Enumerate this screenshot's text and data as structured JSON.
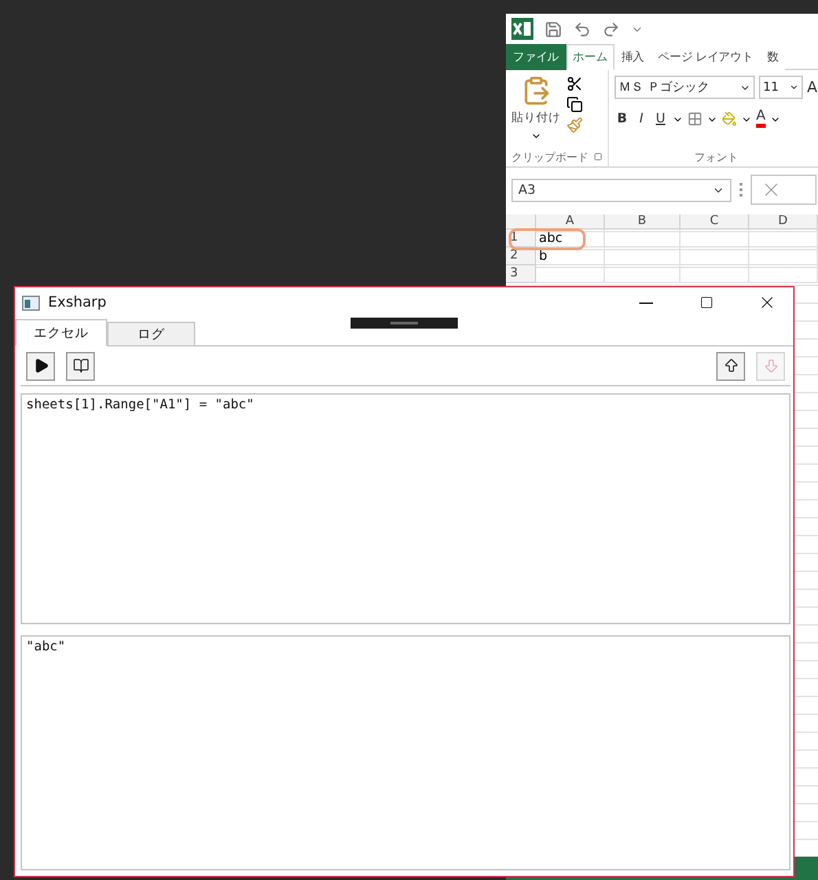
{
  "excel": {
    "tabs": [
      {
        "label": "ファイル",
        "kind": "file",
        "selected": false
      },
      {
        "label": "ホーム",
        "kind": "tab",
        "selected": true
      },
      {
        "label": "挿入",
        "kind": "tab",
        "selected": false
      },
      {
        "label": "ページ レイアウト",
        "kind": "tab",
        "selected": false
      },
      {
        "label": "数",
        "kind": "tab",
        "selected": false
      }
    ],
    "paste_label": "貼り付け",
    "font_name": "ＭＳ Ｐゴシック",
    "font_size": "11",
    "grow_font": "A",
    "format_buttons": [
      "B",
      "I",
      "U"
    ],
    "font_color": "A",
    "groups": [
      "クリップボード",
      "フォント"
    ],
    "name_box": "A3",
    "columns": [
      "A",
      "B",
      "C",
      "D"
    ],
    "rows": [
      {
        "header": "1",
        "cell": "abc",
        "highlighted": true
      },
      {
        "header": "2",
        "cell": "b",
        "highlighted": false
      },
      {
        "header": "3",
        "cell": "",
        "highlighted": false
      }
    ]
  },
  "app": {
    "title": "Exsharp",
    "tabs": [
      {
        "label": "エクセル",
        "selected": true
      },
      {
        "label": "ログ",
        "selected": false
      }
    ],
    "toolbar_left": [
      {
        "kind": "run",
        "disabled": false
      },
      {
        "kind": "book",
        "disabled": false
      }
    ],
    "toolbar_right": [
      {
        "kind": "up",
        "disabled": false
      },
      {
        "kind": "down",
        "disabled": true
      }
    ],
    "editor": {
      "value": "sheets[1].Range[\"A1\"] = \"abc\""
    },
    "output": {
      "value": "\"abc\""
    }
  }
}
